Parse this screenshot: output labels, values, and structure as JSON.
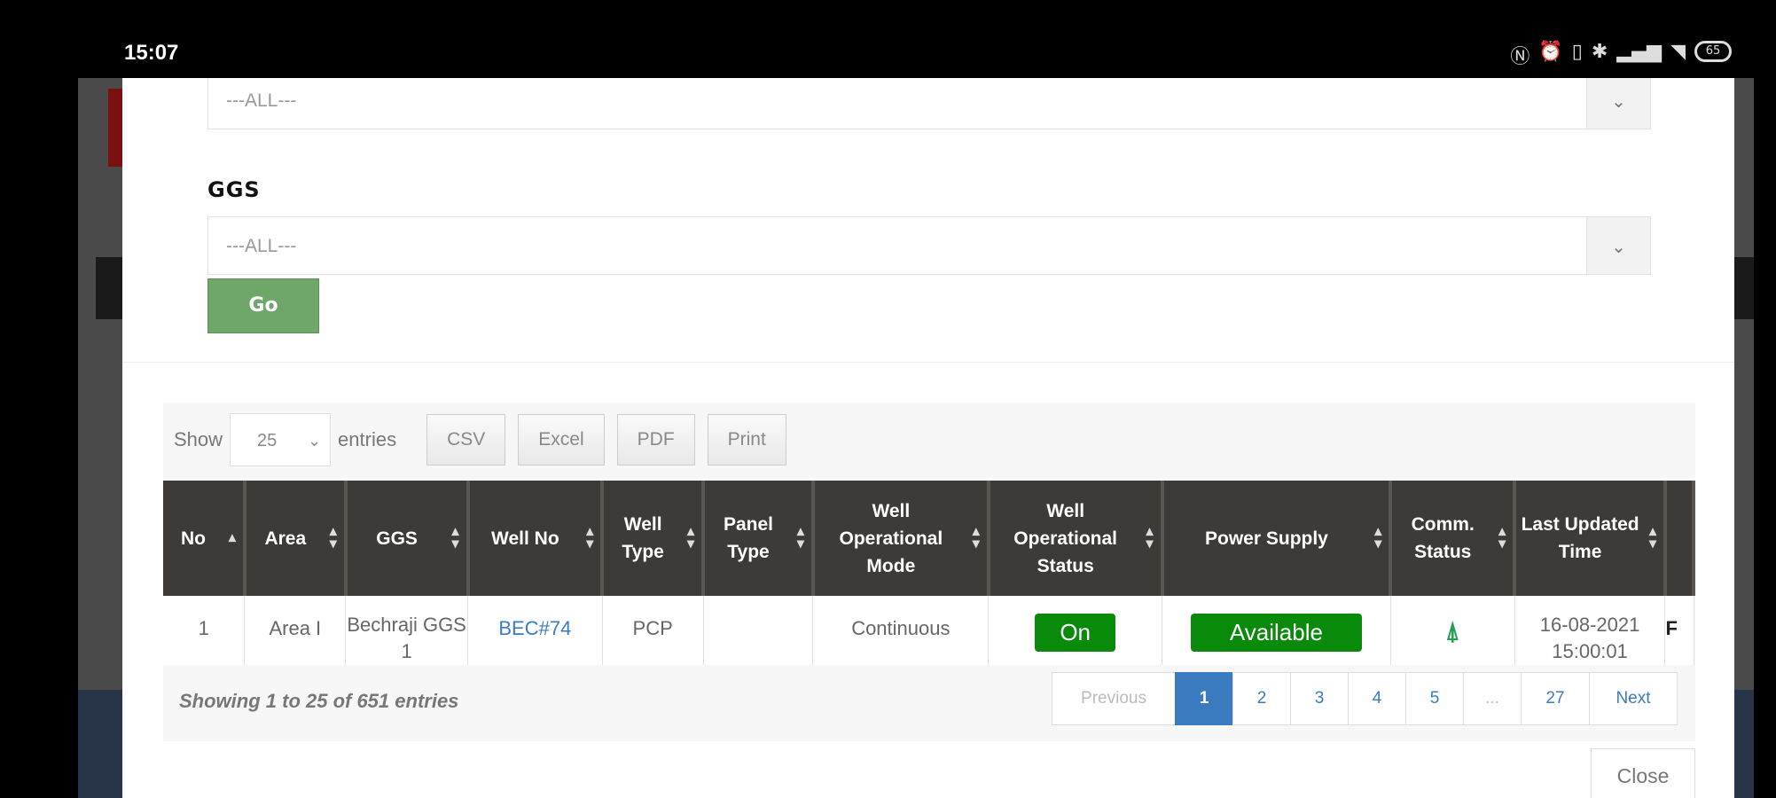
{
  "status_bar": {
    "time": "15:07",
    "icons": [
      "nfc-icon",
      "alarm-icon",
      "vibrate-icon",
      "bluetooth-icon",
      "signal-icon",
      "signal-icon",
      "wifi-icon"
    ],
    "battery": "65"
  },
  "filters": {
    "area_select_value": "---ALL---",
    "ggs_label": "GGS",
    "ggs_select_value": "---ALL---",
    "go_label": "Go"
  },
  "table_controls": {
    "show_label": "Show",
    "page_length": "25",
    "entries_label": "entries",
    "buttons": [
      "CSV",
      "Excel",
      "PDF",
      "Print"
    ]
  },
  "columns": [
    "No",
    "Area",
    "GGS",
    "Well No",
    "Well Type",
    "Panel Type",
    "Well Operational Mode",
    "Well Operational Status",
    "Power Supply",
    "Comm. Status",
    "Last Updated Time"
  ],
  "rows": [
    {
      "no": "1",
      "area": "Area I",
      "ggs": "Bechraji GGS 1",
      "well_no": "BEC#74",
      "well_type": "PCP",
      "panel_type": "",
      "mode": "Continuous",
      "status": "On",
      "power": "Available",
      "comm": "signal-tower-icon",
      "updated": "16-08-2021 15:00:01",
      "extra": "F"
    }
  ],
  "footer": {
    "info": "Showing 1 to 25 of 651 entries",
    "pages": [
      "Previous",
      "1",
      "2",
      "3",
      "4",
      "5",
      "...",
      "27",
      "Next"
    ],
    "active_page": "1",
    "close_label": "Close"
  },
  "colors": {
    "header_bg": "#3d3a37",
    "go_button": "#6fa66a",
    "status_green": "#0a8a0a",
    "link_blue": "#3a7bbf"
  }
}
